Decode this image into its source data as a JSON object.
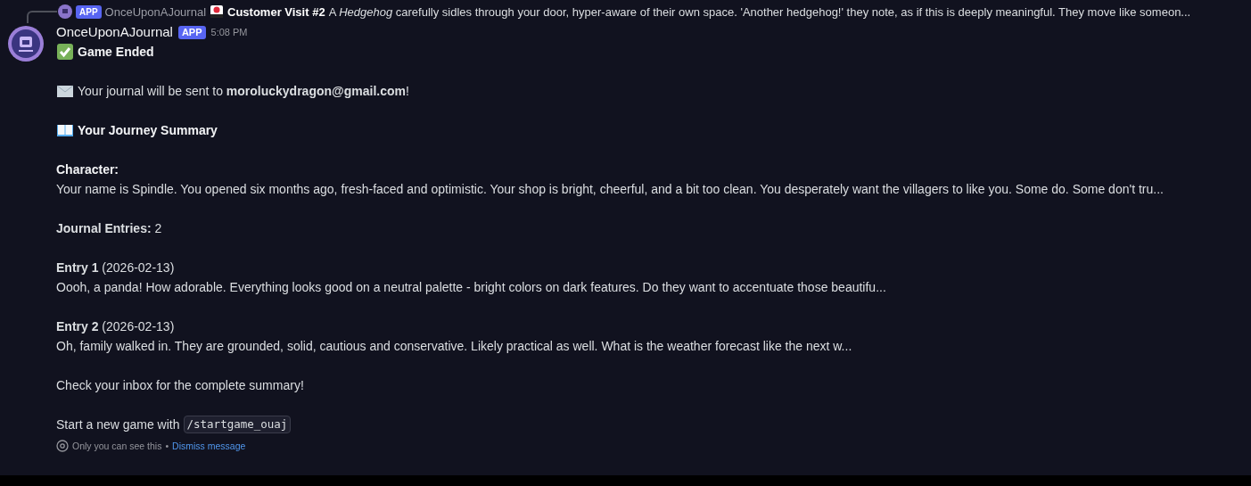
{
  "reply": {
    "author": "OnceUponAJournal",
    "badge": "APP",
    "title": "Customer Visit #2",
    "text": "A *Hedgehog* carefully sidles through your door, hyper-aware of their own space. 'Another hedgehog!' they note, as if this is deeply meaningful. They move like someon..."
  },
  "message": {
    "author": "OnceUponAJournal",
    "badge": "APP",
    "time": "5:08 PM",
    "status": "Game Ended",
    "email_line": "Your journal will be sent to **moroluckydragon@gmail.com**!",
    "summary_title": "Your Journey Summary",
    "character_label": "Character:",
    "character_text": "Your name is Spindle. You opened six months ago, fresh-faced and optimistic. Your shop is bright, cheerful, and a bit too clean. You desperately want the villagers to like you. Some do. Some don't tru...",
    "entries_line": "**Journal Entries:** 2",
    "entries": [
      {
        "heading": "**Entry 1** (2026-02-13)",
        "text": "Oooh, a panda!  How adorable.  Everything looks good on a neutral palette - bright colors on dark features.  Do they want to accentuate those beautifu..."
      },
      {
        "heading": "**Entry 2** (2026-02-13)",
        "text": "Oh, family walked in.  They are grounded,  solid, cautious  and conservative.  Likely practical as well.  What is the weather forecast like the next w..."
      }
    ],
    "inbox_line": "Check your inbox for the complete summary!",
    "start_line": "Start a new game with",
    "command": "/startgame_ouaj",
    "ephemeral_note": "Only you can see this",
    "separator": "•",
    "dismiss_link": "Dismiss message"
  }
}
